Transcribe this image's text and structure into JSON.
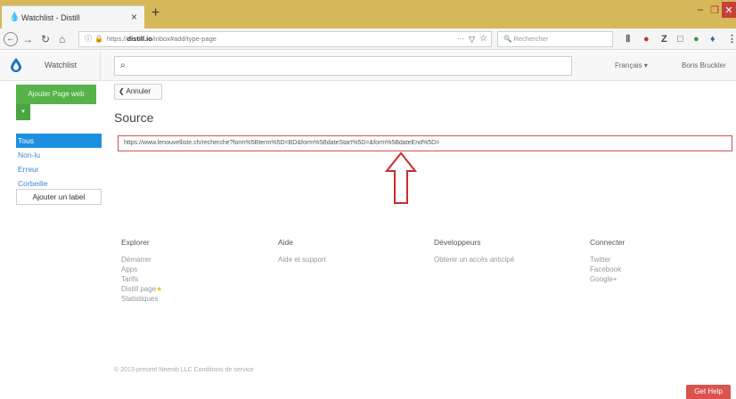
{
  "browser": {
    "tab_title": "Watchlist - Distill",
    "tab_close": "×",
    "new_tab": "+",
    "url_prefix": "https://",
    "url_domain": "distill.io",
    "url_path": "/inbox#add/type-page",
    "url_dots": "···",
    "search_placeholder": "Rechercher",
    "toolbar_icons": [
      "library-icon",
      "ublock-icon",
      "zotero-icon",
      "reader-icon",
      "extension-icon",
      "distill-icon",
      "menu-icon"
    ]
  },
  "header": {
    "brand": "Watchlist",
    "language": "Français ▾",
    "user": "Boris Bruckler"
  },
  "sidebar": {
    "add_page": "Ajouter Page web",
    "add_dropdown": "▾",
    "items": [
      {
        "label": "Tous"
      },
      {
        "label": "Non-lu"
      },
      {
        "label": "Erreur"
      },
      {
        "label": "Corbeille"
      }
    ],
    "add_label": "Ajouter un label"
  },
  "main": {
    "cancel": "❮ Annuler",
    "source_title": "Source",
    "source_url": "https://www.lenouvelliste.ch/recherche?form%5Bterm%5D=BD&form%5BdateStart%5D=&form%5BdateEnd%5D="
  },
  "footer": {
    "columns": [
      {
        "head": "Explorer",
        "links": [
          "Démarrer",
          "Apps",
          "Tarifs",
          "Distill page",
          "Statistiques"
        ]
      },
      {
        "head": "Aide",
        "links": [
          "Aide et support"
        ]
      },
      {
        "head": "Développeurs",
        "links": [
          "Obtenir un accès anticipé"
        ]
      },
      {
        "head": "Connecter",
        "links": [
          "Twitter",
          "Facebook",
          "Google+"
        ]
      }
    ],
    "copyright": "© 2013-present Neemb LLC Conditions de service",
    "get_help": "Get Help"
  },
  "colors": {
    "tabstrip": "#d6b75a",
    "accent_green": "#55b34a",
    "active_blue": "#1d8fe1",
    "input_red": "#d25252",
    "help_red": "#d9534f"
  }
}
